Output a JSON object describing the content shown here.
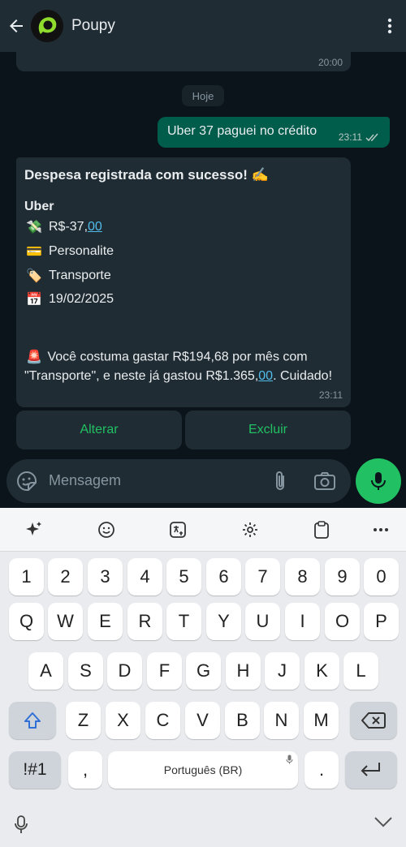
{
  "header": {
    "title": "Poupy"
  },
  "chat": {
    "prev_time": "20:00",
    "day_label": "Hoje",
    "outgoing": {
      "text": "Uber 37 paguei no crédito",
      "time": "23:11"
    },
    "incoming": {
      "title": "Despesa registrada com sucesso! ✍️",
      "name": "Uber",
      "amount_prefix": "R$-37,",
      "amount_cents": "00",
      "card": "Personalite",
      "category": "Transporte",
      "date": "19/02/2025",
      "warning_a": "Você costuma gastar R$194,68 por mês com \"Transporte\", e neste já gastou R$1.365,",
      "warning_cents": "00",
      "warning_b": ". Cuidado!",
      "time": "23:11",
      "emojis": {
        "amount": "💸",
        "card": "💳",
        "category": "🏷️",
        "date": "📅",
        "warning": "🚨"
      }
    },
    "buttons": {
      "alter": "Alterar",
      "delete": "Excluir"
    }
  },
  "composer": {
    "placeholder": "Mensagem"
  },
  "keyboard": {
    "numbers": [
      "1",
      "2",
      "3",
      "4",
      "5",
      "6",
      "7",
      "8",
      "9",
      "0"
    ],
    "row1": [
      "Q",
      "W",
      "E",
      "R",
      "T",
      "Y",
      "U",
      "I",
      "O",
      "P"
    ],
    "row2": [
      "A",
      "S",
      "D",
      "F",
      "G",
      "H",
      "J",
      "K",
      "L"
    ],
    "row3": [
      "Z",
      "X",
      "C",
      "V",
      "B",
      "N",
      "M"
    ],
    "symbols_label": "!#1",
    "comma": ",",
    "space_label": "Português (BR)",
    "period": "."
  },
  "colors": {
    "accent": "#21c063",
    "bubble_out": "#005c4b",
    "bubble_in": "#202c33",
    "link": "#53bdeb"
  }
}
